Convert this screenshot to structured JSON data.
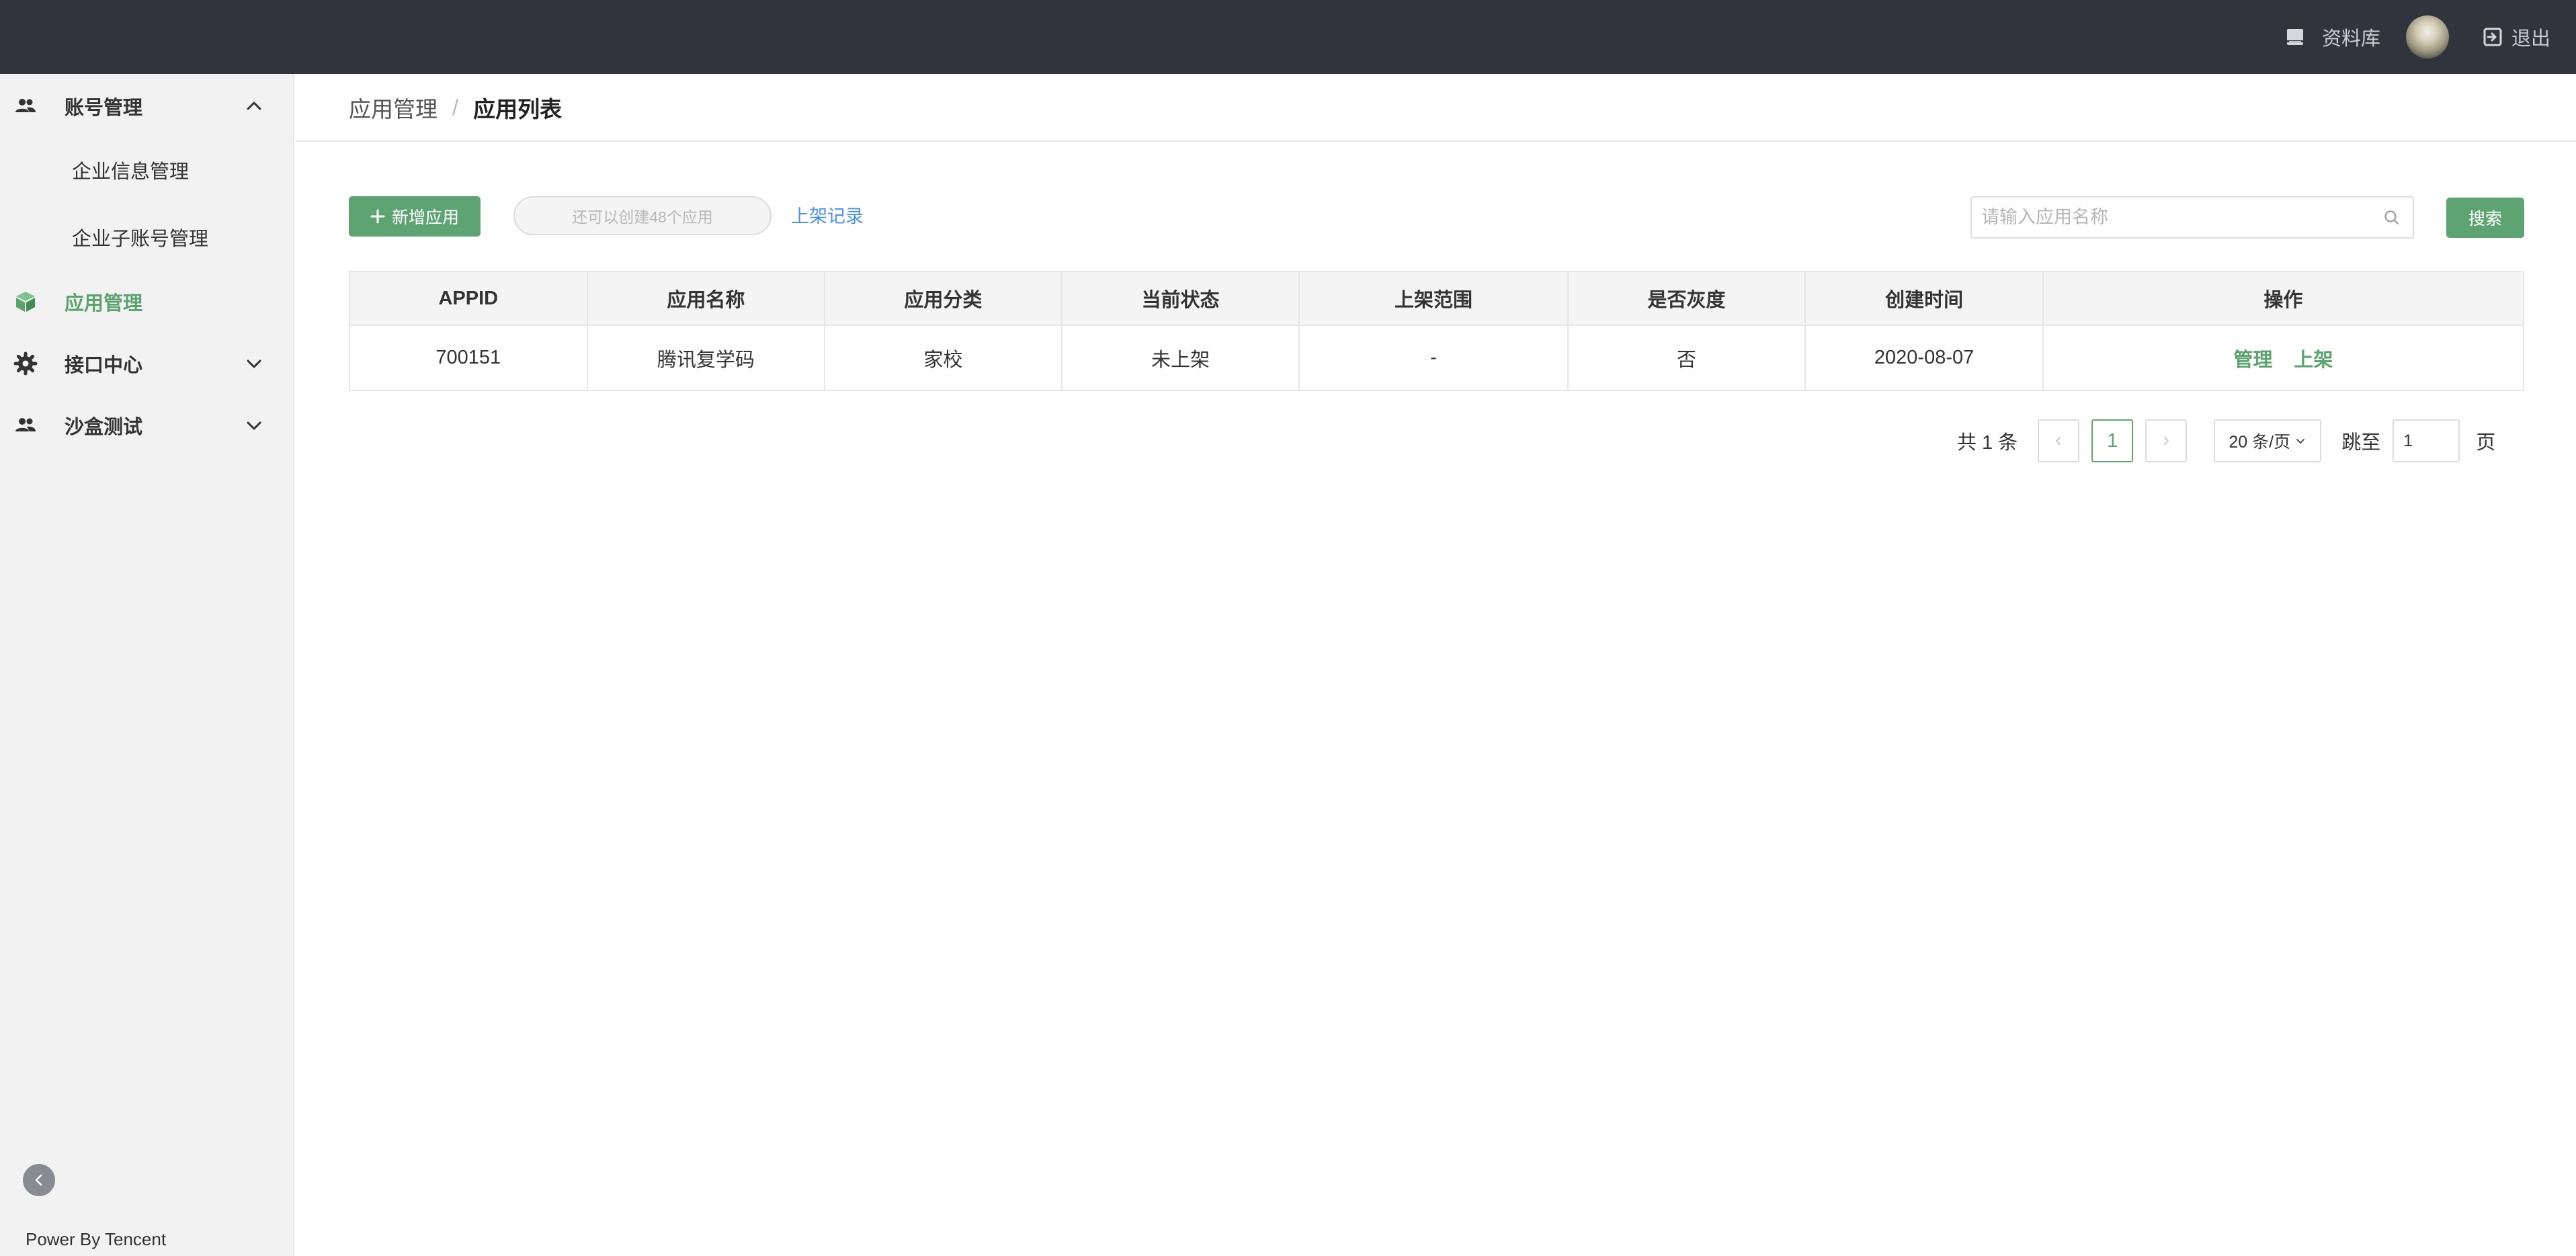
{
  "topbar": {
    "library_label": "资料库",
    "logout_label": "退出"
  },
  "sidebar": {
    "groups": [
      {
        "label": "账号管理",
        "icon": "people-icon",
        "expanded": true,
        "children": [
          {
            "label": "企业信息管理"
          },
          {
            "label": "企业子账号管理"
          }
        ]
      },
      {
        "label": "应用管理",
        "icon": "cube-icon",
        "active": true
      },
      {
        "label": "接口中心",
        "icon": "gear-icon",
        "expanded": false
      },
      {
        "label": "沙盒测试",
        "icon": "people-icon",
        "expanded": false
      }
    ],
    "footer": "Power By Tencent"
  },
  "breadcrumb": {
    "parent": "应用管理",
    "separator": "/",
    "current": "应用列表"
  },
  "toolbar": {
    "add_button": "新增应用",
    "quota_text": "还可以创建48个应用",
    "records_link": "上架记录",
    "search_placeholder": "请输入应用名称",
    "search_button": "搜索"
  },
  "table": {
    "columns": [
      "APPID",
      "应用名称",
      "应用分类",
      "当前状态",
      "上架范围",
      "是否灰度",
      "创建时间",
      "操作"
    ],
    "rows": [
      {
        "appid": "700151",
        "name": "腾讯复学码",
        "category": "家校",
        "status": "未上架",
        "scope": "-",
        "gray": "否",
        "created": "2020-08-07",
        "actions": [
          "管理",
          "上架"
        ]
      }
    ]
  },
  "pagination": {
    "total": "共 1 条",
    "current_page": "1",
    "page_size": "20 条/页",
    "jump_label": "跳至",
    "jump_value": "1",
    "page_unit": "页"
  },
  "colors": {
    "topbar_bg": "#30343d",
    "accent_green": "#5ea372",
    "link_blue": "#4a8fe7",
    "sidebar_bg": "#f2f2f2"
  }
}
